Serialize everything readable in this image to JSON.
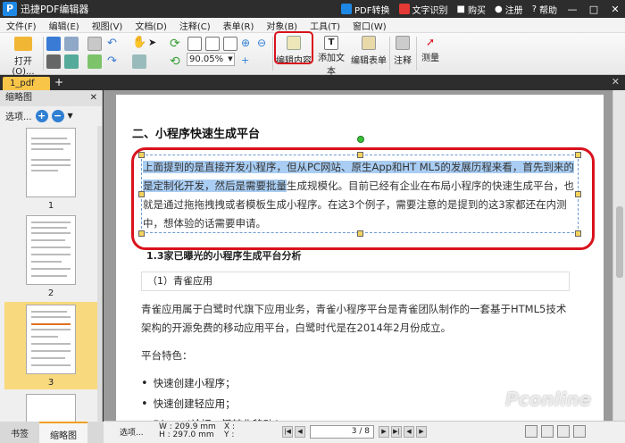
{
  "titlebar": {
    "title": "迅捷PDF编辑器",
    "pdf_convert": "PDF转换",
    "ocr": "文字识别",
    "buy": "购买",
    "register": "注册",
    "help": "帮助"
  },
  "menubar": {
    "items": [
      "文件(F)",
      "编辑(E)",
      "视图(V)",
      "文档(D)",
      "注释(C)",
      "表单(R)",
      "对象(B)",
      "工具(T)",
      "窗口(W)"
    ]
  },
  "toolbar": {
    "open_label": "打开(O)...",
    "zoom_value": "90.05%",
    "edit_content": "编辑内容",
    "add_text": "添加文本",
    "edit_form": "编辑表单",
    "annotate": "注释",
    "measure": "测量"
  },
  "tabs": {
    "doc_tab": "1_pdf"
  },
  "leftpanel": {
    "header": "缩略图",
    "options": "选项...",
    "thumbnails": [
      {
        "num": "1"
      },
      {
        "num": "2"
      },
      {
        "num": "3"
      }
    ],
    "bottom_tabs": [
      "书签",
      "缩略图"
    ]
  },
  "document": {
    "heading": "二、小程序快速生成平台",
    "para1_highlight": "上面提到的是直接开发小程序，但从PC网站、原生App和HT ML5的发展历程来看，首先到来的是定制化开发，然后是需要批量",
    "para1_rest": "生成规模化。目前已经有企业在布局小程序的快速生成平台，也就是通过拖拖拽拽或者模板生成小程序。在这3个例子，需要注意的是提到的这3家都还在内测中，想体验的话需要申请。",
    "subheading": "1.3家已曝光的小程序生成平台分析",
    "box_title": "（1）青雀应用",
    "para2": "青雀应用属于白鹭时代旗下应用业务，青雀小程序平台是青雀团队制作的一套基于HTML5技术架构的开源免费的移动应用平台，白鹭时代是在2014年2月份成立。",
    "platform_label": "平台特色：",
    "bullets": [
      "快速创建小程序；",
      "快速创建轻应用；",
      "Discuz!论坛一键转化移动App；"
    ]
  },
  "statusbar": {
    "options": "选项...",
    "width": "W : 209.9 mm",
    "height": "H : 297.0 mm",
    "x": "X :",
    "y": "Y :",
    "page": "3 / 8"
  },
  "watermark": {
    "brand": "Pconline",
    "sub": "太平洋电脑网"
  }
}
